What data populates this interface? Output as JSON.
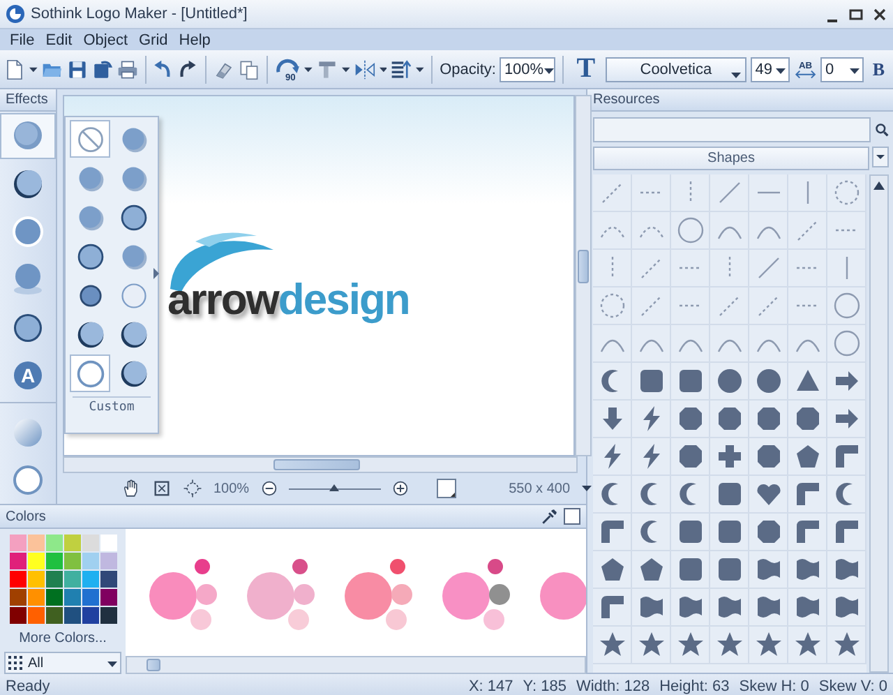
{
  "window": {
    "title": "Sothink Logo Maker - [Untitled*]"
  },
  "menu": [
    "File",
    "Edit",
    "Object",
    "Grid",
    "Help"
  ],
  "toolbar": {
    "rotate_label": "90",
    "opacity_label": "Opacity:",
    "opacity": "100%",
    "text_tool": "T",
    "font": "Coolvetica",
    "font_size": "49",
    "spacing_icon": "AB",
    "spacing": "0",
    "bold": "B"
  },
  "effects": {
    "title": "Effects",
    "items": [
      {
        "kind": "bevel",
        "selected": true
      },
      {
        "kind": "crescent",
        "selected": false
      },
      {
        "kind": "glow",
        "selected": false
      },
      {
        "kind": "reflection",
        "selected": false
      },
      {
        "kind": "ring",
        "selected": false
      },
      {
        "kind": "letter",
        "label": "A",
        "selected": false
      },
      {
        "kind": "gradient",
        "selected": false
      },
      {
        "kind": "outline",
        "selected": false
      }
    ],
    "popup": {
      "items": [
        {
          "kind": "none",
          "selected": true
        },
        {
          "kind": "shadow",
          "selected": false
        },
        {
          "kind": "shadow",
          "selected": false
        },
        {
          "kind": "shadow",
          "selected": false
        },
        {
          "kind": "shadow",
          "selected": false
        },
        {
          "kind": "ring",
          "selected": false
        },
        {
          "kind": "ring",
          "selected": false
        },
        {
          "kind": "shadow",
          "selected": false
        },
        {
          "kind": "dark",
          "selected": false
        },
        {
          "kind": "light",
          "selected": false
        },
        {
          "kind": "crescent",
          "selected": false
        },
        {
          "kind": "crescent",
          "selected": false
        },
        {
          "kind": "outline",
          "selected": true
        },
        {
          "kind": "crescent",
          "selected": false
        }
      ],
      "custom_label": "Custom"
    }
  },
  "canvas": {
    "logo_word_1": "arrow",
    "logo_word_2": "design",
    "zoom": "100%",
    "zoom_slider": {
      "level": 0.5
    },
    "size": "550 x 400"
  },
  "colors": {
    "title": "Colors",
    "swatches": [
      {
        "color": "#f4a0c0"
      },
      {
        "color": "#fbc29a"
      },
      {
        "color": "#8ee88a"
      },
      {
        "color": "#c0d040"
      },
      {
        "color": "#dcdcdc"
      },
      {
        "color": "#ffffff"
      },
      {
        "color": "#e0207a"
      },
      {
        "color": "#ffff20"
      },
      {
        "color": "#20c040"
      },
      {
        "color": "#80c040"
      },
      {
        "color": "#a0d0f0"
      },
      {
        "color": "#c0b8e0"
      },
      {
        "color": "#ff0000"
      },
      {
        "color": "#ffc000"
      },
      {
        "color": "#208050"
      },
      {
        "color": "#40b0a0"
      },
      {
        "color": "#20b0f0"
      },
      {
        "color": "#304878"
      },
      {
        "color": "#a04000"
      },
      {
        "color": "#ff9000"
      },
      {
        "color": "#007020"
      },
      {
        "color": "#2080b0"
      },
      {
        "color": "#2070d0"
      },
      {
        "color": "#800060"
      },
      {
        "color": "#800000"
      },
      {
        "color": "#ff6000"
      },
      {
        "color": "#406020"
      },
      {
        "color": "#205080"
      },
      {
        "color": "#2040a0"
      },
      {
        "color": "#203040"
      }
    ],
    "more": "More Colors...",
    "filter": "All",
    "schemes": [
      {
        "dots": [
          {
            "color": "#f98cbc"
          },
          {
            "color": "#e83e8c"
          },
          {
            "color": "#f5a8c8"
          },
          {
            "color": "#f8c8d8"
          }
        ]
      },
      {
        "dots": [
          {
            "color": "#f0b0cc"
          },
          {
            "color": "#d8508a"
          },
          {
            "color": "#f0b0cc"
          },
          {
            "color": "#f8ccd8"
          }
        ]
      },
      {
        "dots": [
          {
            "color": "#f88ca4"
          },
          {
            "color": "#f0506e"
          },
          {
            "color": "#f5aab8"
          },
          {
            "color": "#f8c8d4"
          }
        ]
      },
      {
        "dots": [
          {
            "color": "#f890c4"
          },
          {
            "color": "#d84a88"
          },
          {
            "color": "#909090"
          },
          {
            "color": "#f8c0d8"
          }
        ]
      },
      {
        "dots": [
          {
            "color": "#f890c0"
          }
        ]
      }
    ]
  },
  "resources": {
    "title": "Resources",
    "category": "Shapes"
  },
  "status_bar": {
    "text": "Ready",
    "fields": [
      "X: 147",
      "Y: 185",
      "Width: 128",
      "Height: 63",
      "Skew H: 0",
      "Skew V: 0"
    ]
  }
}
